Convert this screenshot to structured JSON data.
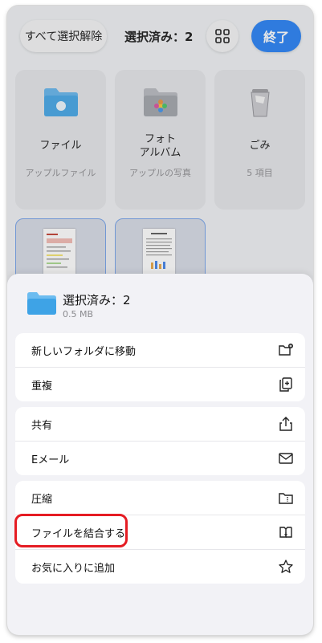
{
  "topbar": {
    "deselect_all": "すべて選択解除",
    "selected_count": "選択済み：2",
    "done": "終了"
  },
  "cards": [
    {
      "title": "ファイル",
      "subtitle": "アップルファイル",
      "icon": "files-folder-icon"
    },
    {
      "title": "フォト\nアルバム",
      "subtitle": "アップルの写真",
      "icon": "photos-folder-icon"
    },
    {
      "title": "ごみ",
      "subtitle": "5 項目",
      "icon": "trash-icon"
    }
  ],
  "sheet": {
    "title": "選択済み：2",
    "size": "0.5 MB",
    "groups": [
      [
        {
          "label": "新しいフォルダに移動",
          "icon": "new-folder-icon"
        },
        {
          "label": "重複",
          "icon": "duplicate-icon"
        }
      ],
      [
        {
          "label": "共有",
          "icon": "share-icon"
        },
        {
          "label": "Eメール",
          "icon": "mail-icon"
        }
      ],
      [
        {
          "label": "圧縮",
          "icon": "compress-icon"
        },
        {
          "label": "ファイルを結合する",
          "icon": "merge-icon"
        },
        {
          "label": "お気に入りに追加",
          "icon": "star-icon"
        }
      ]
    ]
  },
  "colors": {
    "accent": "#1f7cf5",
    "highlight": "#e51c23"
  }
}
